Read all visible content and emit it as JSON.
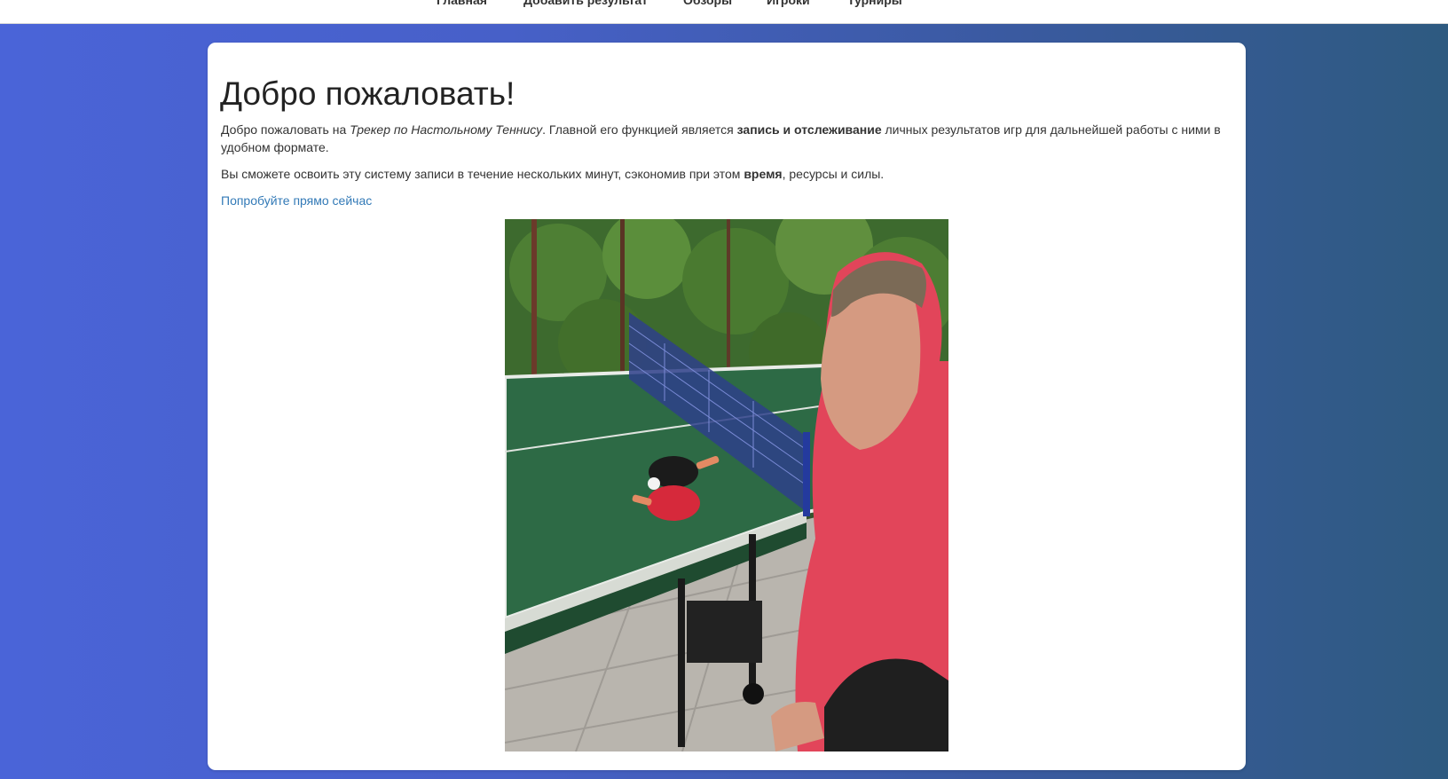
{
  "nav": {
    "items": [
      {
        "label": "Главная"
      },
      {
        "label": "Добавить результат"
      },
      {
        "label": "Обзоры"
      },
      {
        "label": "Игроки"
      },
      {
        "label": "Турниры"
      }
    ]
  },
  "main": {
    "title": "Добро пожаловать!",
    "intro": {
      "prefix": "Добро пожаловать на ",
      "site_name": "Трекер по Настольному Теннису",
      "middle": ". Главной его функцией является ",
      "emphasis": "запись и отслеживание",
      "suffix": " личных результатов игр для дальнейшей работы с ними в удобном формате."
    },
    "second": {
      "prefix": "Вы сможете освоить эту систему записи в течение нескольких минут, сэкономив при этом ",
      "emphasis": "время",
      "suffix": ", ресурсы и силы."
    },
    "cta_link": "Попробуйте прямо сейчас"
  },
  "colors": {
    "link": "#337ab7",
    "background_start": "#4a64d8",
    "background_end": "#2e5a80"
  }
}
